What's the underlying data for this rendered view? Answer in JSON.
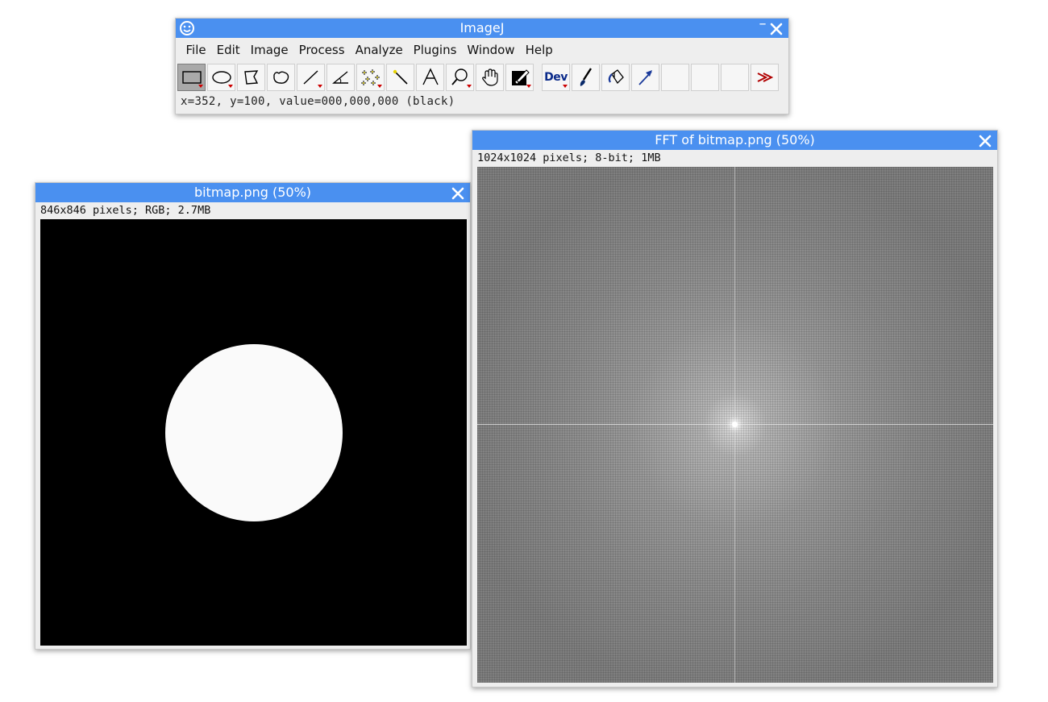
{
  "imagej": {
    "title": "ImageJ",
    "menu": [
      "File",
      "Edit",
      "Image",
      "Process",
      "Analyze",
      "Plugins",
      "Window",
      "Help"
    ],
    "tools": [
      {
        "name": "rectangle-tool-icon",
        "selected": true
      },
      {
        "name": "oval-tool-icon"
      },
      {
        "name": "polygon-tool-icon"
      },
      {
        "name": "freehand-tool-icon"
      },
      {
        "name": "line-tool-icon"
      },
      {
        "name": "angle-tool-icon"
      },
      {
        "name": "multipoint-tool-icon"
      },
      {
        "name": "wand-tool-icon"
      },
      {
        "name": "text-tool-icon"
      },
      {
        "name": "zoom-tool-icon"
      },
      {
        "name": "hand-tool-icon"
      },
      {
        "name": "color-picker-icon"
      },
      {
        "name": "developer-menu-icon",
        "label": "Dev"
      },
      {
        "name": "brush-tool-icon"
      },
      {
        "name": "flood-fill-icon"
      },
      {
        "name": "arrow-tool-icon"
      },
      {
        "name": "more-tools-icon"
      }
    ],
    "status": "x=352, y=100, value=000,000,000 (black)",
    "dev_label": "Dev"
  },
  "bitmap_window": {
    "title": "bitmap.png (50%)",
    "info": "846x846 pixels; RGB; 2.7MB"
  },
  "fft_window": {
    "title": "FFT of bitmap.png (50%)",
    "info": "1024x1024 pixels; 8-bit; 1MB"
  },
  "colors": {
    "titlebar": "#4a90f0",
    "window_bg": "#eeeeee",
    "image_black": "#000000",
    "circle_white": "#fafafa",
    "accent_red": "#cc0000"
  }
}
